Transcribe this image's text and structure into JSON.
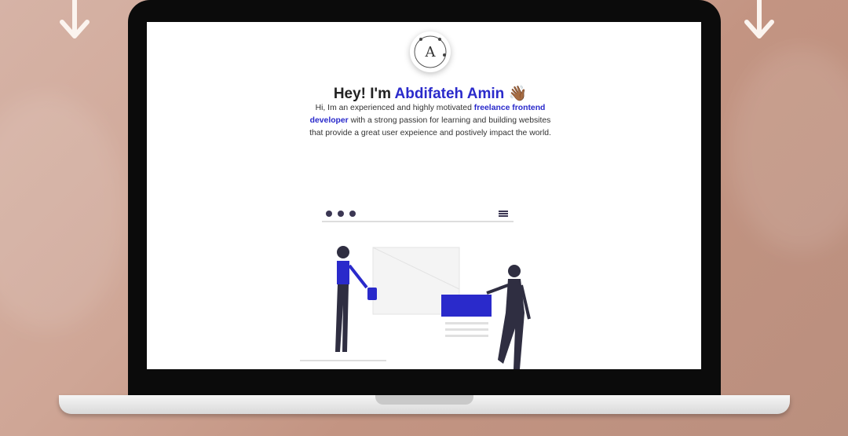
{
  "hero": {
    "avatar_letter": "A",
    "greeting": "Hey! I'm ",
    "name": "Abdifateh Amin",
    "wave_emoji": "👋🏾",
    "intro_part1": "Hi, Im an experienced and highly motivated ",
    "intro_highlight": "freelance frontend developer",
    "intro_part2": " with a strong passion for learning and building websites that provide a great user expeience and postively impact the world."
  },
  "colors": {
    "accent": "#2a2acb",
    "text": "#222222",
    "background_blush": "#cfa696"
  },
  "icons": [
    "down-arrow-icon",
    "hamburger-menu-icon",
    "window-dots-icon"
  ]
}
